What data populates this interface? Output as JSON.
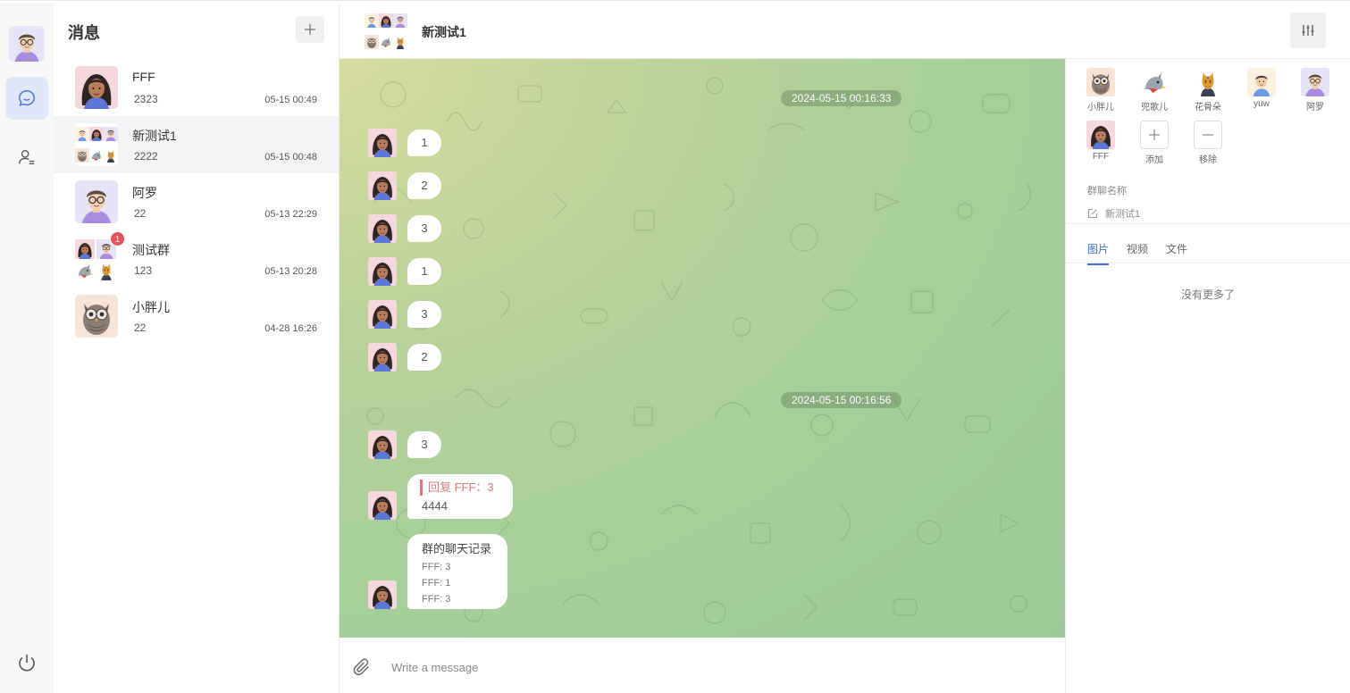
{
  "sidebar": {
    "nav": [
      {
        "icon": "chat-bubble-icon",
        "active": true
      },
      {
        "icon": "contacts-icon",
        "active": false
      }
    ],
    "power_icon": "power-icon"
  },
  "conversation_list": {
    "title": "消息",
    "add_icon": "plus-icon",
    "items": [
      {
        "name": "FFF",
        "preview": "2323",
        "time": "05-15 00:49"
      },
      {
        "name": "新测试1",
        "preview": "2222",
        "time": "05-15 00:48"
      },
      {
        "name": "阿罗",
        "preview": "22",
        "time": "05-13 22:29"
      },
      {
        "name": "测试群",
        "preview": "123",
        "time": "05-13 20:28",
        "badge": "1"
      },
      {
        "name": "小胖儿",
        "preview": "22",
        "time": "04-28 16:26"
      }
    ]
  },
  "chat": {
    "title": "新测试1",
    "settings_icon": "sliders-icon",
    "timestamps": [
      "2024-05-15 00:16:33",
      "2024-05-15 00:16:56"
    ],
    "messages": [
      {
        "text": "1"
      },
      {
        "text": "2"
      },
      {
        "text": "3"
      },
      {
        "text": "1"
      },
      {
        "text": "3"
      },
      {
        "text": "2"
      },
      {
        "text": "3"
      }
    ],
    "reply_message": {
      "quote": "回复 FFF：3",
      "text": "4444"
    },
    "forward_message": {
      "title": "群的聊天记录",
      "lines": [
        "FFF:  3",
        "FFF:  1",
        "FFF:  3"
      ]
    },
    "input": {
      "placeholder": "Write a message",
      "value": ""
    }
  },
  "group_panel": {
    "members": [
      "小胖儿",
      "兜歌儿",
      "花骨朵",
      "yuw",
      "阿罗",
      "FFF"
    ],
    "add_label": "添加",
    "remove_label": "移除",
    "group_name_label": "群聊名称",
    "group_name_value": "新测试1",
    "tabs": [
      "图片",
      "视频",
      "文件"
    ],
    "active_tab": "图片",
    "empty_text": "没有更多了"
  },
  "colors": {
    "accent": "#3b6fe0",
    "badge": "#e4535a",
    "chat_bg_start": "#d7dc9d",
    "chat_bg_end": "#9dcb97"
  }
}
